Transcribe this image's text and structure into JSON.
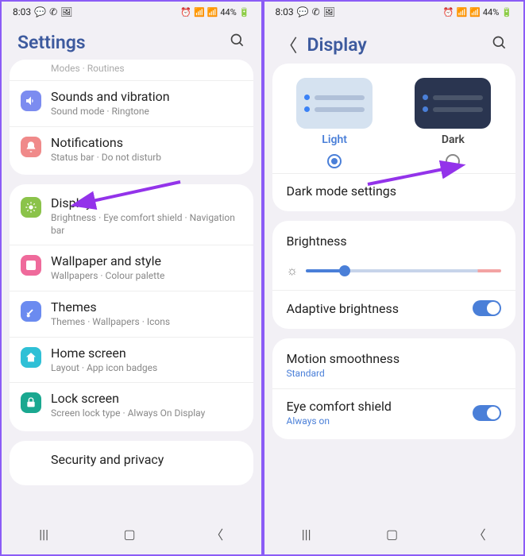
{
  "status": {
    "time": "8:03",
    "battery": "44%"
  },
  "left": {
    "title": "Settings",
    "cutoff_top": "Modes  ·  Routines",
    "items": [
      {
        "title": "Sounds and vibration",
        "sub": "Sound mode  ·  Ringtone",
        "color": "#7c8cf0"
      },
      {
        "title": "Notifications",
        "sub": "Status bar  ·  Do not disturb",
        "color": "#f08a8a"
      }
    ],
    "group2": [
      {
        "title": "Display",
        "sub": "Brightness  ·  Eye comfort shield  ·  Navigation bar",
        "color": "#8bc34a"
      },
      {
        "title": "Wallpaper and style",
        "sub": "Wallpapers  ·  Colour palette",
        "color": "#ef6a9b"
      },
      {
        "title": "Themes",
        "sub": "Themes  ·  Wallpapers  ·  Icons",
        "color": "#6b8bf0"
      },
      {
        "title": "Home screen",
        "sub": "Layout  ·  App icon badges",
        "color": "#2fc0d6"
      },
      {
        "title": "Lock screen",
        "sub": "Screen lock type  ·  Always On Display",
        "color": "#1aa890"
      }
    ],
    "cutoff_bottom": "Security and privacy"
  },
  "right": {
    "title": "Display",
    "themes": {
      "light": "Light",
      "dark": "Dark"
    },
    "dark_mode_settings": "Dark mode settings",
    "brightness": "Brightness",
    "adaptive": "Adaptive brightness",
    "motion": {
      "label": "Motion smoothness",
      "value": "Standard"
    },
    "eye": {
      "label": "Eye comfort shield",
      "value": "Always on"
    }
  }
}
